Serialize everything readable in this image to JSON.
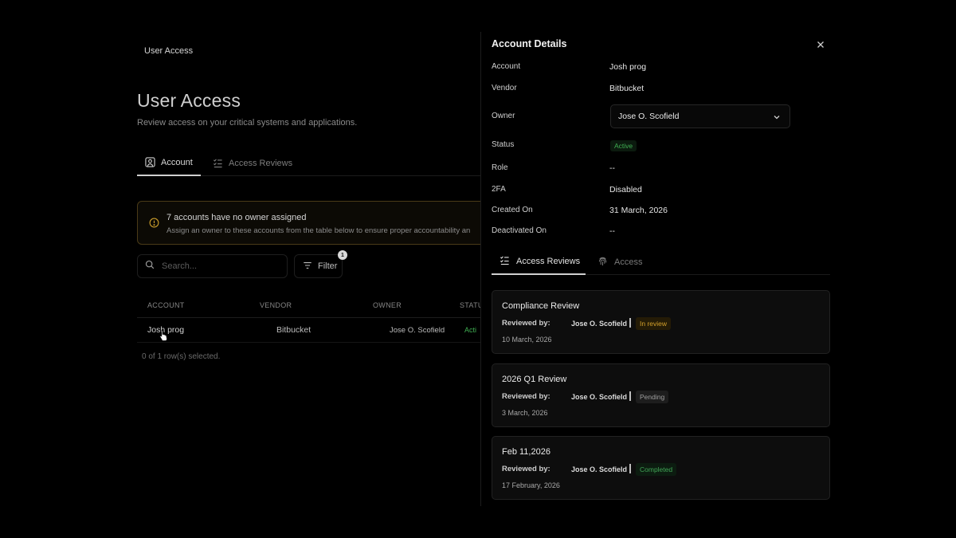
{
  "breadcrumb": "User Access",
  "page": {
    "title": "User Access",
    "subtitle": "Review access on your critical systems and applications."
  },
  "tabs": [
    {
      "label": "Account",
      "icon": "user-square-icon",
      "active": true
    },
    {
      "label": "Access Reviews",
      "icon": "list-checks-icon",
      "active": false
    }
  ],
  "alert": {
    "title": "7 accounts have no owner assigned",
    "text": "Assign an owner to these accounts from the table below to ensure proper accountability an",
    "icon": "alert-circle-icon",
    "accent": "#4a3b17"
  },
  "search": {
    "placeholder": "Search..."
  },
  "filter": {
    "label": "Filter",
    "count": "1"
  },
  "table": {
    "columns": [
      "ACCOUNT",
      "VENDOR",
      "OWNER",
      "STATU"
    ],
    "rows": [
      {
        "account": "Josh prog",
        "vendor": "Bitbucket",
        "owner": "Jose O. Scofield",
        "status": "Acti"
      }
    ],
    "selection": "0 of 1 row(s) selected."
  },
  "panel": {
    "title": "Account Details",
    "fields": {
      "account_label": "Account",
      "account": "Josh prog",
      "vendor_label": "Vendor",
      "vendor": "Bitbucket",
      "owner_label": "Owner",
      "owner": "Jose O. Scofield",
      "status_label": "Status",
      "status": "Active",
      "role_label": "Role",
      "role": "--",
      "twofa_label": "2FA",
      "twofa": "Disabled",
      "created_label": "Created On",
      "created": "31 March, 2026",
      "deactivated_label": "Deactivated On",
      "deactivated": "--"
    },
    "tabs": [
      {
        "label": "Access Reviews",
        "icon": "list-checks-icon",
        "active": true
      },
      {
        "label": "Access",
        "icon": "fingerprint-icon",
        "active": false
      }
    ],
    "reviews": [
      {
        "title": "Compliance Review",
        "reviewed_by_label": "Reviewed by:",
        "reviewer": "Jose O. Scofield",
        "status": "In review",
        "date": "10 March, 2026"
      },
      {
        "title": "2026 Q1 Review",
        "reviewed_by_label": "Reviewed by:",
        "reviewer": "Jose O. Scofield",
        "status": "Pending",
        "date": "3 March, 2026"
      },
      {
        "title": "Feb 11,2026",
        "reviewed_by_label": "Reviewed by:",
        "reviewer": "Jose O. Scofield",
        "status": "Completed",
        "date": "17 February, 2026"
      }
    ]
  },
  "colors": {
    "background": "#000000",
    "active_green": "#3fae52",
    "in_review": "#d4a02b",
    "warning_border": "#4a3b17"
  }
}
